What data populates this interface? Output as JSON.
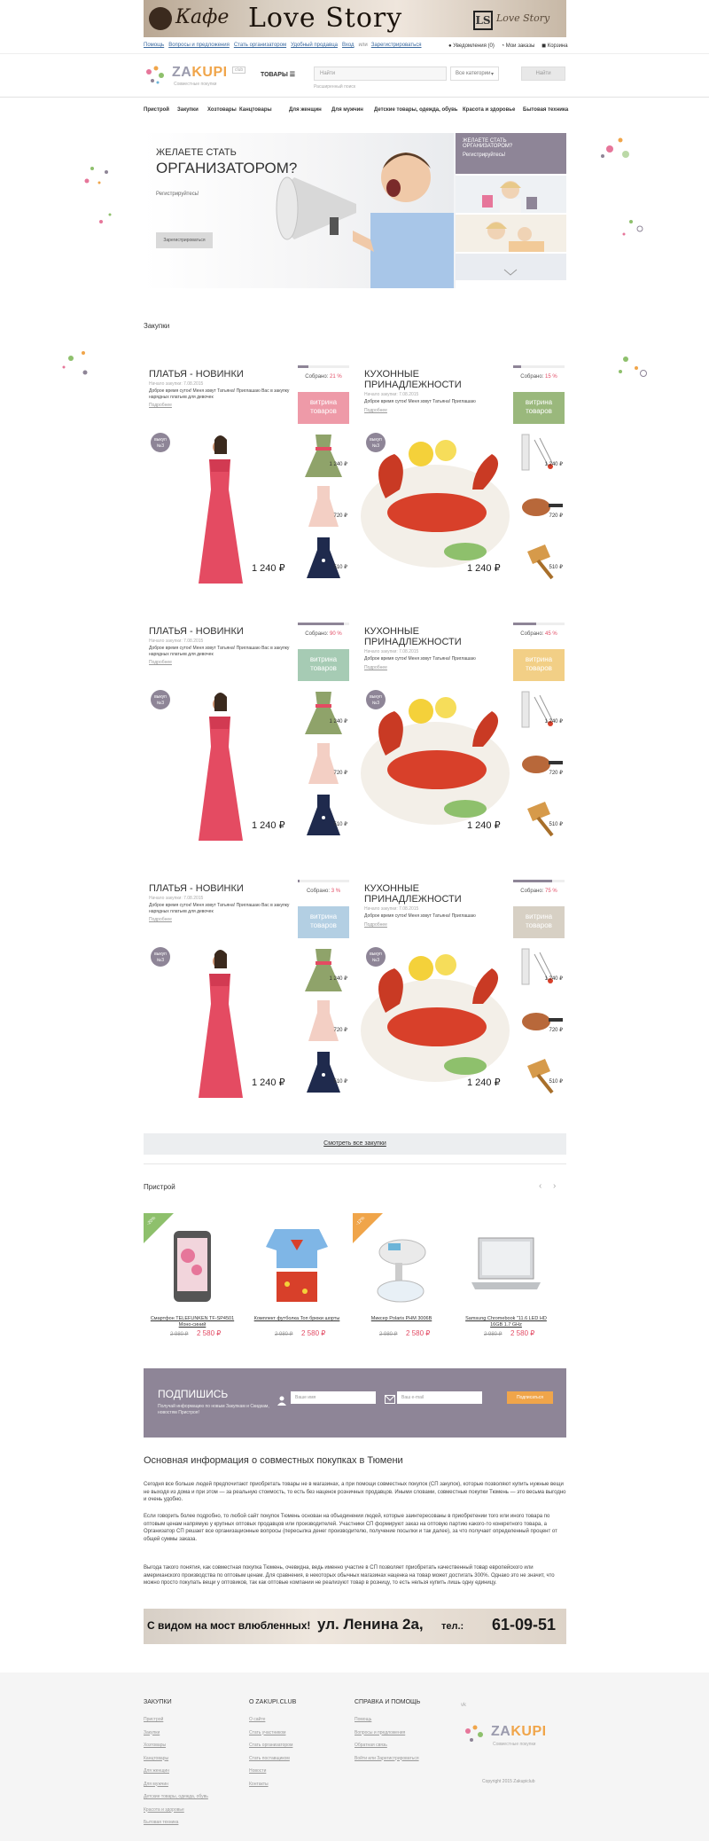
{
  "banner_top": {
    "kafe": "Кафе",
    "love": "Love Story",
    "ls": "LS",
    "script": "Love Story"
  },
  "topline": {
    "links": [
      "Помощь",
      "Вопросы и предложения",
      "Стать организатором",
      "Удобный продавца",
      "Вход",
      "или",
      "Зарегистрироваться"
    ],
    "right": [
      "Уведомления (0)",
      "Мои заказы",
      "Корзина"
    ]
  },
  "header": {
    "logo_main": "ZA",
    "logo_accent": "KUPI",
    "logo_sub": "Совместные покупки",
    "logo_tag": "club",
    "tovary": "ТОВАРЫ",
    "search_placeholder": "Найти",
    "search_category": "Все категории",
    "search_button": "Найти",
    "search_hint": "Расширенный поиск"
  },
  "catnav": [
    "Пристрой",
    "Закупки",
    "Хозтовары",
    "Канцтовары",
    "Для женщин",
    "Для мужчин",
    "Детские товары, одежда, обувь",
    "Красота и здоровье",
    "Бытовая техника"
  ],
  "hero": {
    "line1": "ЖЕЛАЕТЕ СТАТЬ",
    "line2": "ОРГАНИЗАТОРОМ?",
    "reg": "Регистрируйтесь!",
    "button": "Зарегистрироваться",
    "right_card_line1": "ЖЕЛАЕТЕ СТАТЬ",
    "right_card_line2": "ОРГАНИЗАТОРОМ?",
    "right_card_line3": "Регистрируйтесь!"
  },
  "section_zakupki": "Закупки",
  "cards": [
    {
      "title": "ПЛАТЬЯ - НОВИНКИ",
      "date": "Начало закупки: 7.08.2015",
      "desc": "Доброе время суток! Меня зовут Татьяна! Приглашаю Вас в закупку нарядных платьев для девочек",
      "more": "Подробнее",
      "collected_label": "Собрано:",
      "collected": "21 %",
      "progress": 0.21,
      "vitrina": "витрина товаров",
      "vcolor": "#ee9aa8",
      "badge": "выкуп №3",
      "price": "1 240 ₽",
      "side_prices": [
        "1 240 ₽",
        "720 ₽",
        "510 ₽"
      ]
    },
    {
      "title": "КУХОННЫЕ ПРИНАДЛЕЖНОСТИ",
      "date": "Начало закупки: 7.08.2015",
      "desc": "Доброе время суток! Меня зовут Татьяна! Приглашаю",
      "more": "Подробнее",
      "collected_label": "Собрано:",
      "collected": "15 %",
      "progress": 0.15,
      "vitrina": "витрина товаров",
      "vcolor": "#9ab87c",
      "badge": "выкуп №3",
      "price": "1 240 ₽",
      "side_prices": [
        "1 240 ₽",
        "720 ₽",
        "510 ₽"
      ]
    },
    {
      "title": "ПЛАТЬЯ - НОВИНКИ",
      "date": "Начало закупки: 7.08.2015",
      "desc": "Доброе время суток! Меня зовут Татьяна! Приглашаю Вас в закупку нарядных платьев для девочек",
      "more": "Подробнее",
      "collected_label": "Собрано:",
      "collected": "90 %",
      "progress": 0.9,
      "vitrina": "витрина товаров",
      "vcolor": "#a6cbb4",
      "badge": "выкуп №3",
      "price": "1 240 ₽",
      "side_prices": [
        "1 240 ₽",
        "720 ₽",
        "510 ₽"
      ]
    },
    {
      "title": "КУХОННЫЕ ПРИНАДЛЕЖНОСТИ",
      "date": "Начало закупки: 7.08.2015",
      "desc": "Доброе время суток! Меня зовут Татьяна! Приглашаю",
      "more": "Подробнее",
      "collected_label": "Собрано:",
      "collected": "45 %",
      "progress": 0.45,
      "vitrina": "витрина товаров",
      "vcolor": "#f2cf86",
      "badge": "выкуп №3",
      "price": "1 240 ₽",
      "side_prices": [
        "1 240 ₽",
        "720 ₽",
        "510 ₽"
      ]
    },
    {
      "title": "ПЛАТЬЯ - НОВИНКИ",
      "date": "Начало закупки: 7.08.2015",
      "desc": "Доброе время суток! Меня зовут Татьяна! Приглашаю Вас в закупку нарядных платьев для девочек",
      "more": "Подробнее",
      "collected_label": "Собрано:",
      "collected": "3 %",
      "progress": 0.03,
      "vitrina": "витрина товаров",
      "vcolor": "#b3cfe3",
      "badge": "выкуп №3",
      "price": "1 240 ₽",
      "side_prices": [
        "1 240 ₽",
        "720 ₽",
        "510 ₽"
      ]
    },
    {
      "title": "КУХОННЫЕ ПРИНАДЛЕЖНОСТИ",
      "date": "Начало закупки: 7.08.2015",
      "desc": "Доброе время суток! Меня зовут Татьяна! Приглашаю",
      "more": "Подробнее",
      "collected_label": "Собрано:",
      "collected": "75 %",
      "progress": 0.75,
      "vitrina": "витрина товаров",
      "vcolor": "#d7d0c4",
      "badge": "выкуп №3",
      "price": "1 240 ₽",
      "side_prices": [
        "1 240 ₽",
        "720 ₽",
        "510 ₽"
      ]
    }
  ],
  "all_button": "Смотреть все закупки",
  "section_pristroy": "Пристрой",
  "products": [
    {
      "name": "Смартфон TELEFUNKEN TF-SP4501 Моно-синий",
      "old": "2 980 ₽",
      "new": "2 580 ₽",
      "tag": "-20%"
    },
    {
      "name": "Комплект футболка Топ брюки шорты",
      "old": "2 980 ₽",
      "new": "2 580 ₽",
      "tag": ""
    },
    {
      "name": "Миксер Polaris PHM 3006B",
      "old": "2 980 ₽",
      "new": "2 580 ₽",
      "tag": "-12%"
    },
    {
      "name": "Samsung Chromebook \"11.6 LED HD 16GB 1.7 GHz",
      "old": "2 980 ₽",
      "new": "2 580 ₽",
      "tag": ""
    }
  ],
  "subscribe": {
    "title": "ПОДПИШИСЬ",
    "text": "Получай информацию по новым Закупкам и Скидкам, новостям Пристроя!",
    "name_placeholder": "Ваше имя",
    "email_placeholder": "Ваш e-mail",
    "button": "Подписаться"
  },
  "info": {
    "title": "Основная информация о совместных покупках в Тюмени",
    "p1": "Сегодня все больше людей предпочитают приобретать товары не в магазинах, а при помощи совместных покупок (СП закупок), которые позволяют купить нужные вещи не выходя из дома и при этом — за реальную стоимость, то есть без наценок розничных продавцов. Иными словами, совместные покупки Тюмень — это весьма выгодно и очень удобно.",
    "p2": "Если говорить более подробно, то любой сайт покупок Тюмень основан на объединении людей, которые заинтересованы в приобретении того или иного товара по оптовым ценам напрямую у крупных оптовых продавцов или производителей. Участники СП формируют заказ на оптовую партию какого-то конкретного товара, а Организатор СП решает все организационные вопросы (пересылка денег производителю, получение посылки и так далее), за что получает определенный процент от общей суммы заказа.",
    "p3": "Выгода такого понятия, как совместная покупка Тюмень, очевидна, ведь именно участие в СП позволяет приобретать качественный товар европейского или американского производства по оптовым ценам. Для сравнения, в некоторых обычных магазинах наценка на товар может достигать 300%. Однако это не значит, что можно просто покупать вещи у оптовиков, так как оптовые компании не реализуют товар в розницу, то есть нельзя купить лишь одну единицу."
  },
  "banner_bottom": {
    "t1": "С видом на мост влюбленных!",
    "t2": "ул. Ленина 2а,",
    "t3_label": "тел.:",
    "t3": "61-09-51"
  },
  "footer": {
    "col1_title": "ЗАКУПКИ",
    "col1": [
      "Пристрой",
      "Закупки",
      "Хозтовары",
      "Канцтовары",
      "Для женщин",
      "Для мужчин",
      "Детские товары, одежда, обувь",
      "Красота и здоровье",
      "Бытовая техника"
    ],
    "col2_title": "О ZAKUPI.CLUB",
    "col2": [
      "О сайте",
      "Стать участником",
      "Стать организатором",
      "Стать поставщиком",
      "Новости",
      "Контакты"
    ],
    "col3_title": "СПРАВКА И ПОМОЩЬ",
    "col3": [
      "Помощь",
      "Вопросы и предложения",
      "Обратная связь",
      "Войти или Зарегистрироваться"
    ],
    "vk": "vk",
    "copyright": "Copyright 2015 Zakupiclub"
  },
  "colors": {
    "accent": "#8e8597",
    "price_red": "#e24b64",
    "orange": "#f0a54a"
  }
}
